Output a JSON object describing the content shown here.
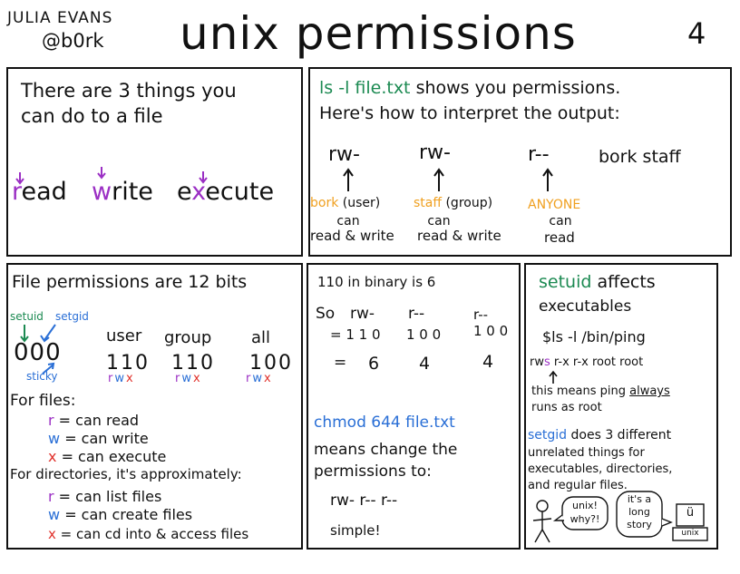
{
  "header": {
    "author_name": "JULIA EVANS",
    "author_handle": "@b0rk",
    "title": "unix permissions",
    "page_number": "4"
  },
  "panel1": {
    "intro_line1": "There are 3 things you",
    "intro_line2": "can do to a file",
    "actions": [
      {
        "letter": "r",
        "rest": "ead"
      },
      {
        "letter": "w",
        "rest": "rite"
      },
      {
        "prefix": "e",
        "letter": "x",
        "rest": "ecute"
      }
    ]
  },
  "panel2": {
    "command": "ls -l file.txt",
    "line1_rest": "shows you permissions.",
    "line2": "Here's how to interpret the output:",
    "perm_groups": [
      {
        "perm": "rw-",
        "who": "bork",
        "who_note": "(user)",
        "can": "can",
        "what": "read & write"
      },
      {
        "perm": "rw-",
        "who": "staff",
        "who_note": "(group)",
        "can": "can",
        "what": "read & write"
      },
      {
        "perm": "r--",
        "who": "ANYONE",
        "who_note": "",
        "can": "can",
        "what": "read"
      }
    ],
    "owner_text": "bork staff"
  },
  "panel3": {
    "heading": "File permissions are 12 bits",
    "setuid": "setuid",
    "setgid": "setgid",
    "sticky": "sticky",
    "special_bits": "000",
    "columns": [
      {
        "label": "user",
        "bits": "110",
        "r": "r",
        "w": "w",
        "x": "x"
      },
      {
        "label": "group",
        "bits": "110",
        "r": "r",
        "w": "w",
        "x": "x"
      },
      {
        "label": "all",
        "bits": "100",
        "r": "r",
        "w": "w",
        "x": "x"
      }
    ],
    "files_heading": "For files:",
    "files_items": [
      {
        "letter": "r",
        "text": "= can read"
      },
      {
        "letter": "w",
        "text": "= can write"
      },
      {
        "letter": "x",
        "text": "= can execute"
      }
    ],
    "dirs_heading": "For directories, it's approximately:",
    "dirs_items": [
      {
        "letter": "r",
        "text": "= can list files"
      },
      {
        "letter": "w",
        "text": "= can create files"
      },
      {
        "letter": "x",
        "text": "= can cd into & access files"
      }
    ]
  },
  "panel4": {
    "binary_line": "110  in  binary  is  6",
    "so": "So",
    "perms": [
      "rw-",
      "r--",
      "r--"
    ],
    "binaries": [
      "= 1 1 0",
      "1 0 0",
      "1 0 0"
    ],
    "decimals": [
      "=",
      "6",
      "4",
      "4"
    ],
    "chmod_cmd": "chmod   644  file.txt",
    "means_line1": "means change the",
    "means_line2": "permissions to:",
    "result": "rw-   r--   r--",
    "simple": "simple!"
  },
  "panel5": {
    "setuid_word": "setuid",
    "affects": "affects",
    "executables": "executables",
    "command": "$ls -l /bin/ping",
    "ping_perm_prefix": "rw",
    "ping_perm_s": "s",
    "ping_rest": "r-x  r-x  root root",
    "note_line1_pre": "this means ping",
    "note_always": "always",
    "note_line2": "runs as root",
    "setgid_word": "setgid",
    "setgid_rest": "does 3 different",
    "setgid_line2": "unrelated things for",
    "setgid_line3": "executables, directories,",
    "setgid_line4": "and regular files.",
    "bubble1_line1": "unix!",
    "bubble1_line2": "why?!",
    "bubble2_line1": "it's a",
    "bubble2_line2": "long",
    "bubble2_line3": "story",
    "computer_face": "ü",
    "computer_label": "unix"
  },
  "colors": {
    "purple": "#9b2fc4",
    "green": "#1c8a52",
    "orange": "#f0a020",
    "blue": "#2a6fd6",
    "red": "#e0302a"
  }
}
